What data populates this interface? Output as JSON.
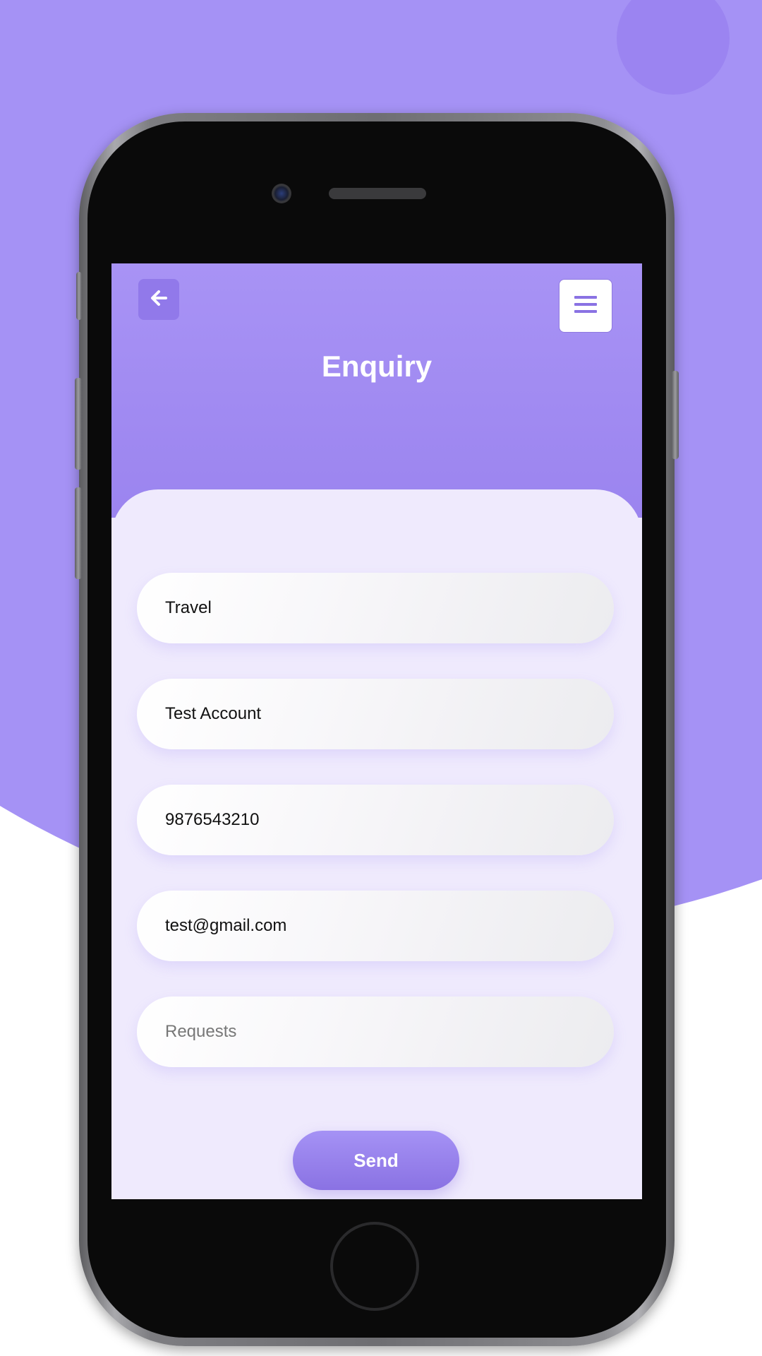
{
  "colors": {
    "background_accent": "#a592f5",
    "header": "#a893f5",
    "card": "#efeafd",
    "button": "#8a72e3"
  },
  "header": {
    "title": "Enquiry",
    "back_icon": "arrow-left-icon",
    "menu_icon": "hamburger-menu-icon"
  },
  "form": {
    "fields": [
      {
        "name": "service",
        "value": "Travel"
      },
      {
        "name": "name",
        "value": "Test Account"
      },
      {
        "name": "phone",
        "value": "9876543210"
      },
      {
        "name": "email",
        "value": "test@gmail.com"
      },
      {
        "name": "requests",
        "placeholder": "Requests"
      }
    ],
    "send_label": "Send"
  }
}
